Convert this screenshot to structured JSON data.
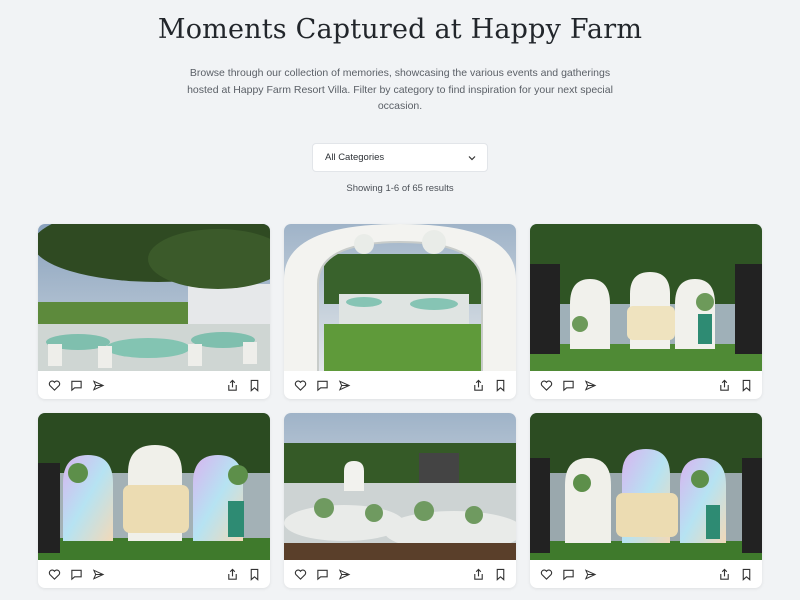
{
  "header": {
    "title": "Moments Captured at Happy Farm",
    "description": "Browse through our collection of memories, showcasing the various events and gatherings hosted at Happy Farm Resort Villa. Filter by category to find inspiration for your next special occasion."
  },
  "filter": {
    "selected": "All Categories",
    "icon": "chevron-down-icon"
  },
  "results": {
    "text": "Showing 1-6 of 65 results"
  },
  "gallery": {
    "card_actions": [
      "heart-icon",
      "comment-icon",
      "send-icon",
      "share-icon",
      "bookmark-icon"
    ],
    "cards": [
      {
        "scene": "outdoor reception with teal tables under a tree"
      },
      {
        "scene": "white arched entrance to garden reception"
      },
      {
        "scene": "arched floral backdrop with cream throne bench"
      },
      {
        "scene": "arched backdrop with colored lighting and bench"
      },
      {
        "scene": "banquet tables with floral centerpieces"
      },
      {
        "scene": "arched stage with lights and cream bench"
      }
    ]
  }
}
